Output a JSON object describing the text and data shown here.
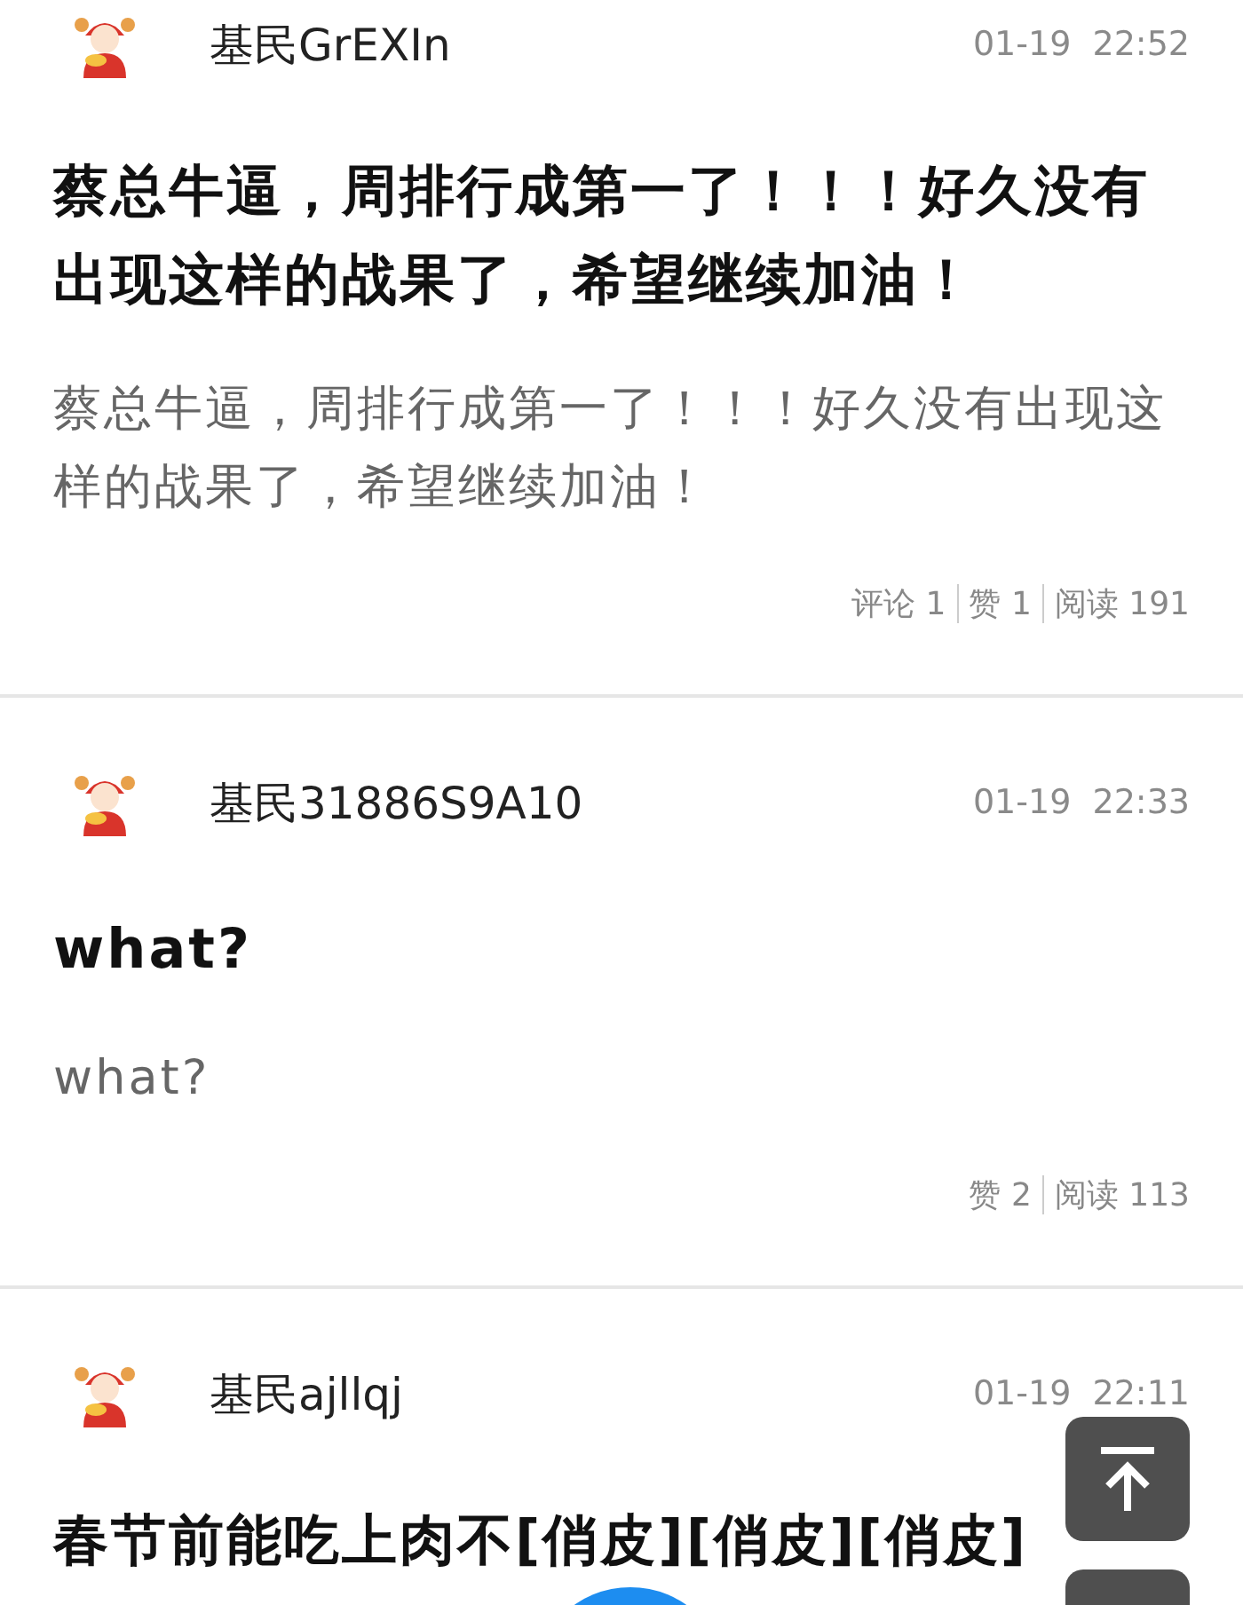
{
  "posts": [
    {
      "username": "基民GrEXIn",
      "time": "01-19  22:52",
      "title": "蔡总牛逼，周排行成第一了！！！好久没有出现这样的战果了，希望继续加油！",
      "body": "蔡总牛逼，周排行成第一了！！！好久没有出现这样的战果了，希望继续加油！",
      "stats": [
        "评论 1",
        "赞 1",
        "阅读 191"
      ]
    },
    {
      "username": "基民31886S9A10",
      "time": "01-19  22:33",
      "title": "what?",
      "body": "what?",
      "stats": [
        "赞 2",
        "阅读 113"
      ]
    },
    {
      "username": "基民ajllqj",
      "time": "01-19  22:11",
      "title": "春节前能吃上肉不[俏皮][俏皮][俏皮]"
    }
  ]
}
